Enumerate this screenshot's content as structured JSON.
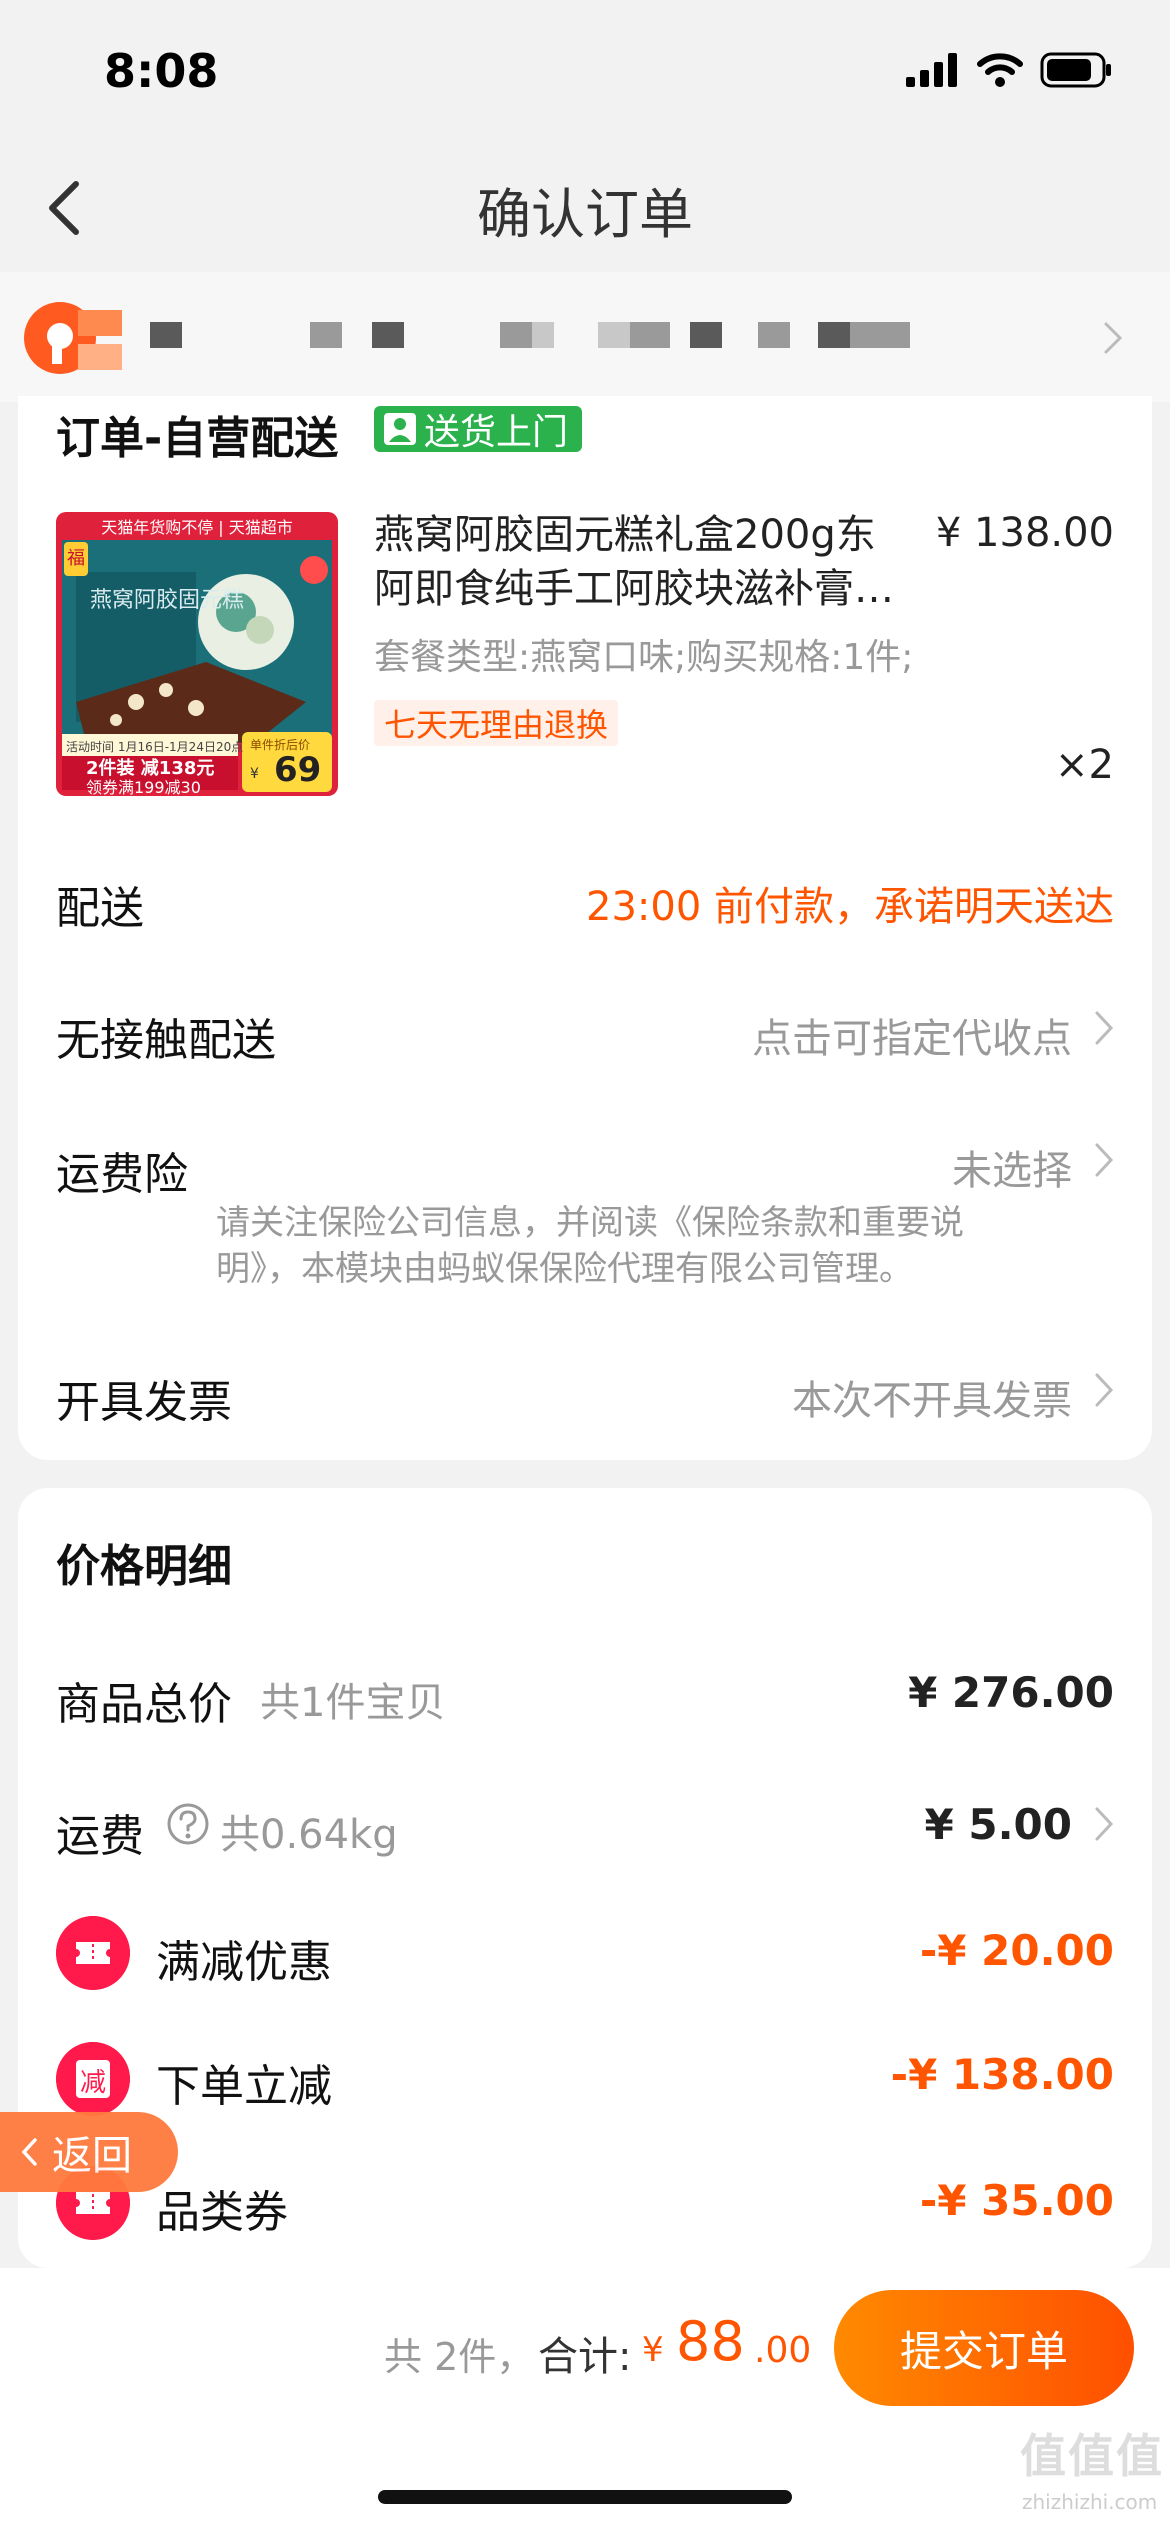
{
  "status_bar": {
    "time": "8:08"
  },
  "nav": {
    "title": "确认订单"
  },
  "order": {
    "title": "订单-自营配送",
    "delivery_tag": "送货上门",
    "product": {
      "title": "燕窝阿胶固元糕礼盒200g东阿即食纯手工阿胶块滋补膏…",
      "price": "¥ 138.00",
      "spec": "套餐类型:燕窝口味;购买规格:1件;",
      "badge": "七天无理由退换",
      "qty": "×2",
      "thumb": {
        "banner": "天猫年货购不停 | 天猫超市",
        "brand": "福",
        "name": "燕窝阿胶固元糕",
        "date_range": "活动时间 1月16日-1月24日20点",
        "promo_line": "2件装 减138元",
        "coupon_line": "领券满199减30",
        "unit_label": "单件折后价",
        "unit_price": "69",
        "currency": "¥"
      }
    },
    "rows": {
      "delivery_label": "配送",
      "delivery_value": "23:00 前付款，承诺明天送达",
      "contactless_label": "无接触配送",
      "contactless_value": "点击可指定代收点",
      "insurance_label": "运费险",
      "insurance_value": "未选择",
      "insurance_note": "请关注保险公司信息，并阅读《保险条款和重要说明》，本模块由蚂蚁保保险代理有限公司管理。",
      "invoice_label": "开具发票",
      "invoice_value": "本次不开具发票"
    }
  },
  "price_detail": {
    "title": "价格明细",
    "goods_total_label": "商品总价",
    "goods_total_sub": "共1件宝贝",
    "goods_total_value": "¥ 276.00",
    "shipping_label": "运费",
    "shipping_sub": "共0.64kg",
    "shipping_value": "¥ 5.00",
    "discounts": [
      {
        "label": "满减优惠",
        "value": "-¥ 20.00",
        "icon": "ticket-icon"
      },
      {
        "label": "下单立减",
        "value": "-¥ 138.00",
        "icon": "jian-icon",
        "glyph": "减"
      },
      {
        "label": "品类券",
        "value": "-¥ 35.00",
        "icon": "ticket-icon"
      }
    ]
  },
  "float_back": {
    "label": "返回"
  },
  "bottom": {
    "count": "共 2件，",
    "total_label": "合计:",
    "currency": "¥",
    "total_int": "88",
    "total_dec": ".00",
    "submit": "提交订单"
  },
  "watermark": {
    "logo": "值值值",
    "url": "zhizhizhi.com"
  },
  "colors": {
    "accent": "#ff5500",
    "green_tag": "#2bb24c",
    "discount_red": "#ff1a4b"
  }
}
